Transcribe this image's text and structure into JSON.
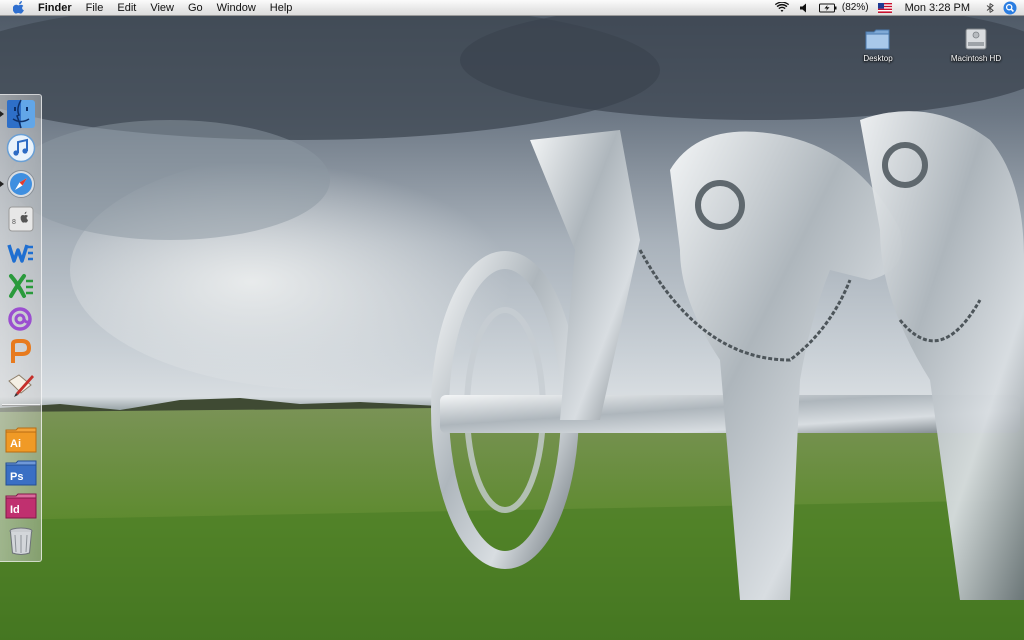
{
  "menubar": {
    "app_name": "Finder",
    "menus": [
      "File",
      "Edit",
      "View",
      "Go",
      "Window",
      "Help"
    ],
    "status": {
      "wifi_icon": "wifi-icon",
      "volume_icon": "speaker-icon",
      "battery_icon": "battery-icon",
      "battery_percent": "(82%)",
      "input_icon": "us-flag-icon",
      "clock": "Mon 3:28 PM",
      "extra_icon": "bluetooth-icon",
      "spotlight_icon": "spotlight-icon"
    }
  },
  "desktop_icons": [
    {
      "label": "Desktop",
      "icon": "folder-icon"
    },
    {
      "label": "Macintosh HD",
      "icon": "hard-drive-icon"
    }
  ],
  "dock": {
    "items": [
      {
        "name": "finder",
        "icon": "finder-icon",
        "running": true
      },
      {
        "name": "itunes",
        "icon": "itunes-icon",
        "running": false
      },
      {
        "name": "safari",
        "icon": "safari-icon",
        "running": true
      },
      {
        "name": "system-preferences",
        "icon": "apple-app-icon",
        "running": false
      },
      {
        "name": "word",
        "icon": "word-icon",
        "running": false
      },
      {
        "name": "excel",
        "icon": "excel-icon",
        "running": false
      },
      {
        "name": "entourage",
        "icon": "entourage-icon",
        "running": false
      },
      {
        "name": "powerpoint",
        "icon": "powerpoint-icon",
        "running": false
      },
      {
        "name": "textedit",
        "icon": "pen-paper-icon",
        "running": false
      },
      {
        "name": "illustrator",
        "icon": "illustrator-icon",
        "label": "Ai",
        "running": false
      },
      {
        "name": "photoshop",
        "icon": "photoshop-icon",
        "label": "Ps",
        "running": false
      },
      {
        "name": "indesign",
        "icon": "indesign-icon",
        "label": "Id",
        "running": false
      },
      {
        "name": "trash",
        "icon": "trash-icon",
        "running": false
      }
    ]
  },
  "colors": {
    "menubar_bg": "#e9e9e9",
    "spotlight_blue": "#2a7de1",
    "ai_orange": "#f09a26",
    "ps_blue": "#3a6fc4",
    "id_pink": "#c0306f"
  }
}
